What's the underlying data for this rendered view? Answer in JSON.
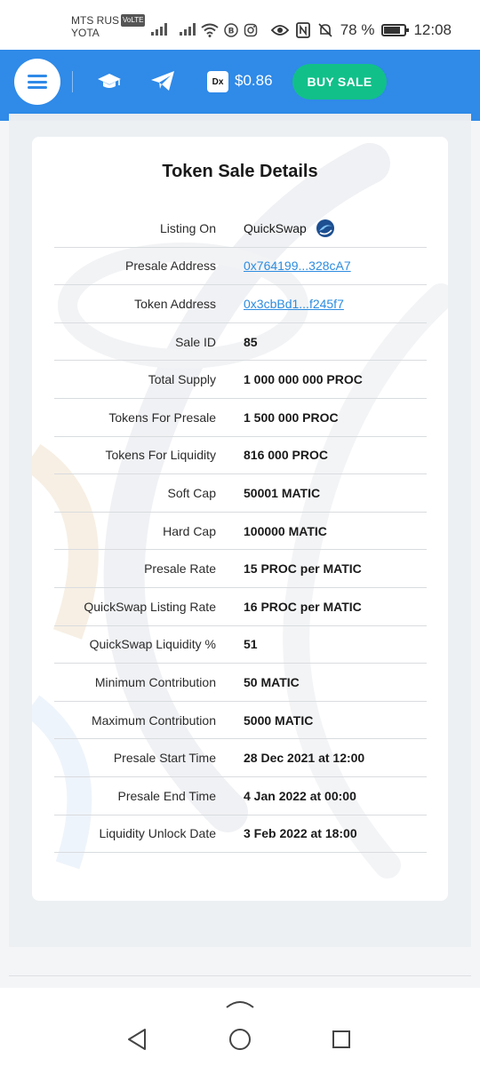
{
  "status_bar": {
    "carrier1": "MTS RUS",
    "volte": "VoLTE",
    "carrier2": "YOTA",
    "battery_percent": "78 %",
    "battery_level": 0.78,
    "time": "12:08"
  },
  "header": {
    "dx_badge": "Dx",
    "price": "$0.86",
    "buy_label": "BUY SALE",
    "accent_color": "#2f8ae8",
    "buy_color": "#11c089"
  },
  "card": {
    "title": "Token Sale Details",
    "rows": [
      {
        "label": "Listing On",
        "value": "QuickSwap"
      },
      {
        "label": "Presale Address",
        "value": "0x764199...328cA7"
      },
      {
        "label": "Token Address",
        "value": "0x3cbBd1...f245f7"
      },
      {
        "label": "Sale ID",
        "value": "85"
      },
      {
        "label": "Total Supply",
        "value": "1 000 000 000 PROC"
      },
      {
        "label": "Tokens For Presale",
        "value": "1 500 000 PROC"
      },
      {
        "label": "Tokens For Liquidity",
        "value": "816 000 PROC"
      },
      {
        "label": "Soft Cap",
        "value": "50001 MATIC"
      },
      {
        "label": "Hard Cap",
        "value": "100000 MATIC"
      },
      {
        "label": "Presale Rate",
        "value": "15 PROC per MATIC"
      },
      {
        "label": "QuickSwap Listing Rate",
        "value": "16 PROC per MATIC"
      },
      {
        "label": "QuickSwap Liquidity %",
        "value": "51"
      },
      {
        "label": "Minimum Contribution",
        "value": "50 MATIC"
      },
      {
        "label": "Maximum Contribution",
        "value": "5000 MATIC"
      },
      {
        "label": "Presale Start Time",
        "value": "28 Dec 2021 at 12:00"
      },
      {
        "label": "Presale End Time",
        "value": "4 Jan 2022 at 00:00"
      },
      {
        "label": "Liquidity Unlock Date",
        "value": "3 Feb 2022 at 18:00"
      }
    ]
  }
}
